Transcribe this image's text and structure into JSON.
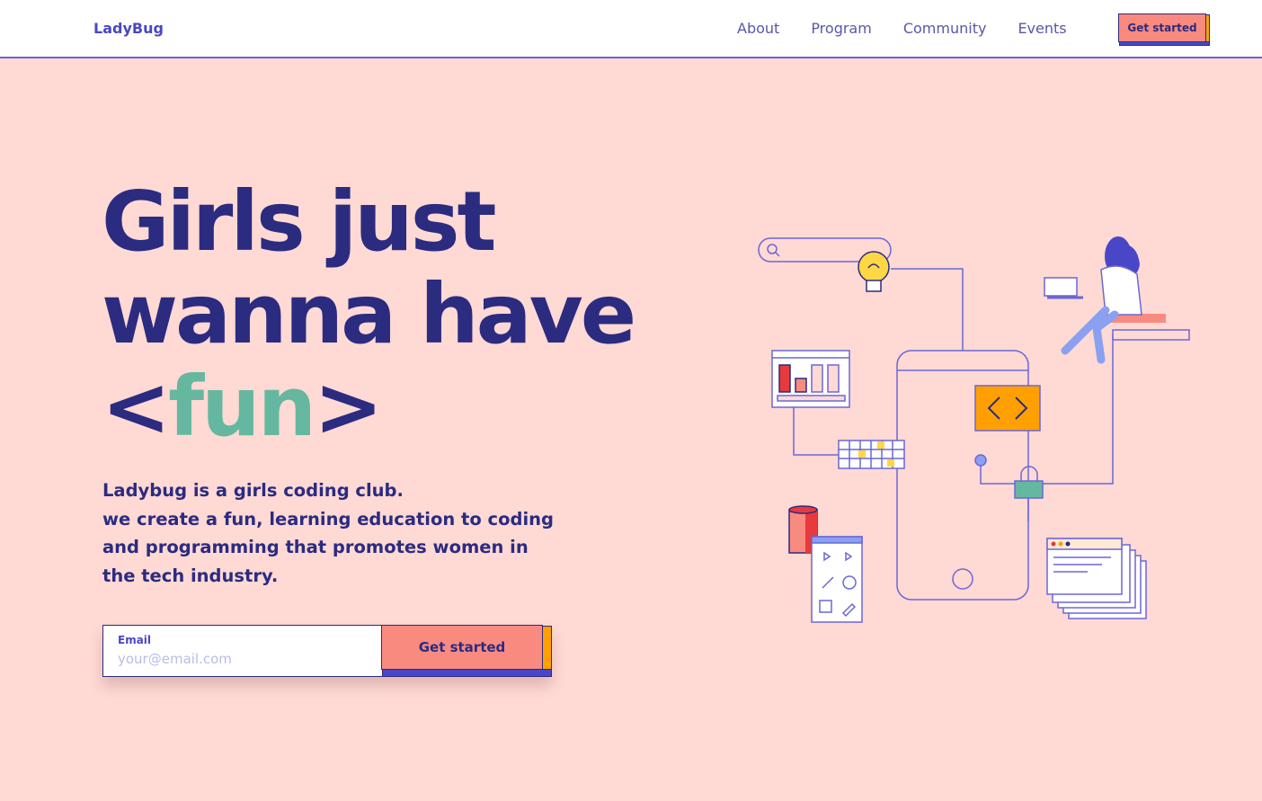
{
  "header": {
    "logo": "LadyBug",
    "nav": [
      {
        "label": "About"
      },
      {
        "label": "Program"
      },
      {
        "label": "Community"
      },
      {
        "label": "Events"
      }
    ],
    "cta_label": "Get started"
  },
  "hero": {
    "title_line1": "Girls just",
    "title_line2": "wanna have",
    "title_open": "<",
    "title_highlight": "fun",
    "title_close": ">",
    "desc_line1": "Ladybug is a girls coding club.",
    "desc_line2": "we create a fun, learning education to coding",
    "desc_line3": "and programming that promotes women in",
    "desc_line4": "the tech industry."
  },
  "form": {
    "email_label": "Email",
    "email_placeholder": "your@email.com",
    "email_value": "",
    "submit_label": "Get started"
  },
  "colors": {
    "background": "#ffd9d4",
    "primary": "#2b2b80",
    "accent": "#4a46c8",
    "highlight": "#65b89f",
    "button": "#f98a80",
    "orange": "#ffa000"
  }
}
